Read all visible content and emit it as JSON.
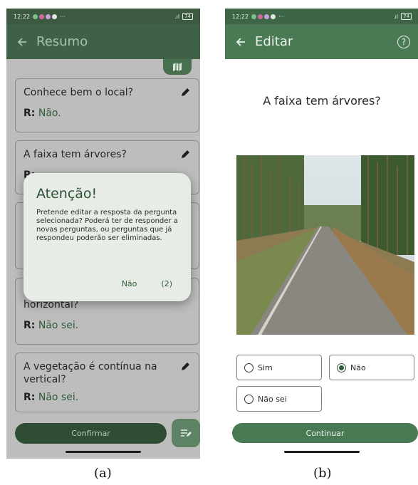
{
  "left": {
    "status": {
      "time": "12:22",
      "battery": "74"
    },
    "title": "Resumo",
    "cards": [
      {
        "question": "Conhece bem o local?",
        "answer_prefix": "R:",
        "answer": "Não."
      },
      {
        "question": "A faixa tem árvores?",
        "answer_prefix": "R:",
        "answer": ""
      },
      {
        "question": "",
        "answer_prefix": "",
        "answer": ""
      },
      {
        "question": "horizontal?",
        "answer_prefix": "R:",
        "answer": "Não sei."
      },
      {
        "question": "A vegetação é contínua na vertical?",
        "answer_prefix": "R:",
        "answer": "Não sei."
      }
    ],
    "dialog": {
      "title": "Atenção!",
      "body": "Pretende editar a resposta da pergunta selecionada? Poderá ter de responder a novas perguntas, ou perguntas que já respondeu poderão ser eliminadas.",
      "no": "Não",
      "countdown": "(2)"
    },
    "confirm": "Confirmar"
  },
  "right": {
    "status": {
      "time": "12:22",
      "battery": "74"
    },
    "title": "Editar",
    "question": "A faixa tem árvores?",
    "options": [
      {
        "label": "Sim",
        "selected": false
      },
      {
        "label": "Não",
        "selected": true
      },
      {
        "label": "Não sei",
        "selected": false
      }
    ],
    "continue": "Continuar"
  },
  "captions": {
    "a": "(a)",
    "b": "(b)"
  }
}
